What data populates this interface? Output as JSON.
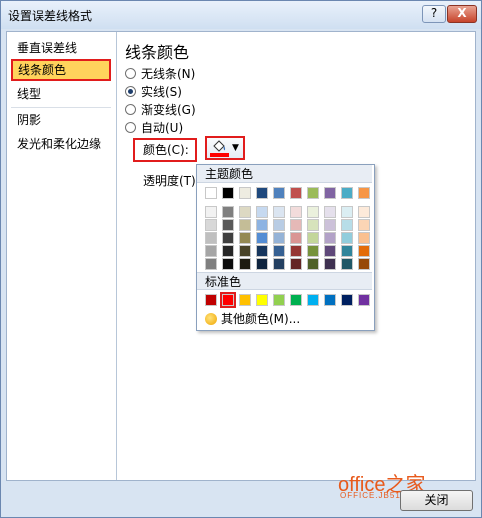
{
  "window": {
    "title": "设置误差线格式",
    "help_label": "?",
    "close_label": "X"
  },
  "nav": {
    "items": [
      {
        "label": "垂直误差线"
      },
      {
        "label": "线条颜色"
      },
      {
        "label": "线型"
      },
      {
        "label": "阴影"
      },
      {
        "label": "发光和柔化边缘"
      }
    ],
    "selected_index": 1
  },
  "panel": {
    "title": "线条颜色",
    "options": [
      {
        "label": "无线条(N)",
        "checked": false
      },
      {
        "label": "实线(S)",
        "checked": true
      },
      {
        "label": "渐变线(G)",
        "checked": false
      },
      {
        "label": "自动(U)",
        "checked": false
      }
    ],
    "color_label": "颜色(C):",
    "transparency_label": "透明度(T):",
    "current_color": "#ff0000"
  },
  "dropdown": {
    "theme_header": "主题颜色",
    "theme_colors": [
      "#ffffff",
      "#000000",
      "#eeece1",
      "#1f497d",
      "#4f81bd",
      "#c0504d",
      "#9bbb59",
      "#8064a2",
      "#4bacc6",
      "#f79646"
    ],
    "shade_rows": [
      [
        "#f2f2f2",
        "#7f7f7f",
        "#ddd9c3",
        "#c6d9f0",
        "#dbe5f1",
        "#f2dcdb",
        "#ebf1dd",
        "#e5e0ec",
        "#dbeef3",
        "#fdeada"
      ],
      [
        "#d8d8d8",
        "#595959",
        "#c4bd97",
        "#8db3e2",
        "#b8cce4",
        "#e5b9b7",
        "#d7e3bc",
        "#ccc1d9",
        "#b7dde8",
        "#fbd5b5"
      ],
      [
        "#bfbfbf",
        "#3f3f3f",
        "#938953",
        "#548dd4",
        "#95b3d7",
        "#d99694",
        "#c3d69b",
        "#b2a2c7",
        "#92cddc",
        "#fac08f"
      ],
      [
        "#a5a5a5",
        "#262626",
        "#494429",
        "#17365d",
        "#366092",
        "#953734",
        "#76923c",
        "#5f497a",
        "#31859b",
        "#e36c09"
      ],
      [
        "#7f7f7f",
        "#0c0c0c",
        "#1d1b10",
        "#0f243e",
        "#244061",
        "#632423",
        "#4f6128",
        "#3f3151",
        "#205867",
        "#974806"
      ]
    ],
    "standard_header": "标准色",
    "standard_colors": [
      "#c00000",
      "#ff0000",
      "#ffc000",
      "#ffff00",
      "#92d050",
      "#00b050",
      "#00b0f0",
      "#0070c0",
      "#002060",
      "#7030a0"
    ],
    "standard_selected_index": 1,
    "more_colors_label": "其他颜色(M)..."
  },
  "watermark": {
    "brand": "office之家",
    "url": "OFFICE.JB51.NET"
  },
  "footer": {
    "close_label": "关闭"
  }
}
